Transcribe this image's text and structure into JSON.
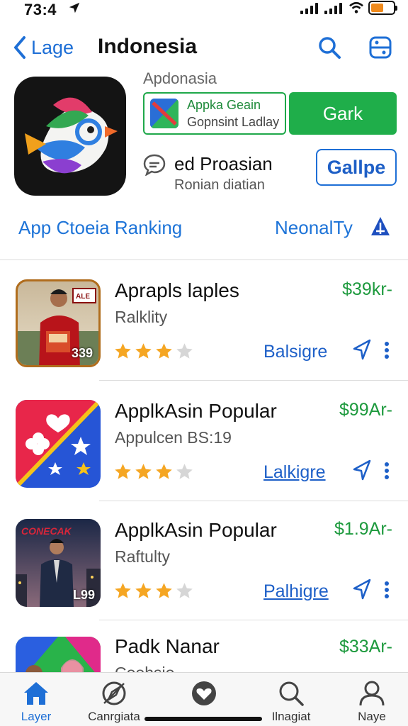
{
  "status": {
    "time": "73:4"
  },
  "nav": {
    "back_label": "Lage",
    "title": "Indonesia"
  },
  "featured": {
    "subtitle": "Apdonasia",
    "card_line1": "Appka Geain",
    "card_line2": "Gopnsint Ladlay",
    "get_label": "Gark",
    "line1": "ed Proasian",
    "line2": "Ronian diatian",
    "gallery_label": "Gallpe"
  },
  "section": {
    "left": "App Ctoeia Ranking",
    "right": "NeonalTy"
  },
  "apps": [
    {
      "name": "Aprapls laples",
      "sub": "Ralklity",
      "price": "$39kr-",
      "rating": 3,
      "link": "Balsigre",
      "badge": "339",
      "underline": false
    },
    {
      "name": "ApplkAsin Popular",
      "sub": "Appulcen BS:19",
      "price": "$99Ar-",
      "rating": 3,
      "link": "Lalkigre",
      "badge": "",
      "underline": true
    },
    {
      "name": "ApplkAsin Popular",
      "sub": "Raftulty",
      "price": "$1.9Ar-",
      "rating": 3,
      "link": "Palhigre",
      "badge": "L99",
      "underline": true
    },
    {
      "name": "Padk Nanar",
      "sub": "Coohsio",
      "price": "$33Ar-",
      "rating": 0,
      "link": "",
      "badge": "",
      "underline": false
    }
  ],
  "icon_banner_3": "CONECAK",
  "icon_banner_1": "ALE",
  "tabs": [
    {
      "label": "Layer",
      "icon": "home-icon"
    },
    {
      "label": "Canrgiata",
      "icon": "compass-icon"
    },
    {
      "label": "",
      "icon": "heart-badge-icon"
    },
    {
      "label": "Ilnagiat",
      "icon": "search-icon"
    },
    {
      "label": "Naye",
      "icon": "person-icon"
    }
  ],
  "colors": {
    "accent": "#1e6fd6",
    "green": "#1fae4a",
    "price": "#1e9a3e",
    "star": "#f5a623"
  }
}
